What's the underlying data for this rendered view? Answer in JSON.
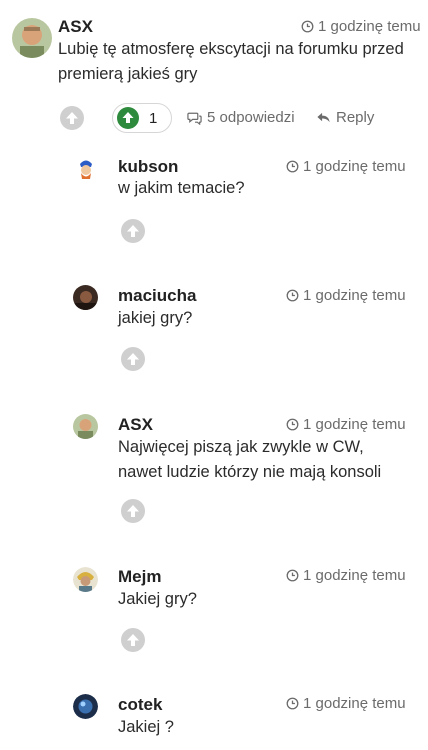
{
  "main_comment": {
    "author": "ASX",
    "time": "1 godzinę temu",
    "lines": [
      "Lubię tę atmosferę ekscytacji na forumku przed",
      "premierą jakieś gry"
    ],
    "votes": "1",
    "replies_label": "5 odpowiedzi",
    "reply_label": "Reply"
  },
  "replies": [
    {
      "author": "kubson",
      "time": "1 godzinę temu",
      "lines": [
        "w jakim temacie?"
      ]
    },
    {
      "author": "maciucha",
      "time": "1 godzinę temu",
      "lines": [
        "jakiej gry?"
      ]
    },
    {
      "author": "ASX",
      "time": "1 godzinę temu",
      "lines": [
        "Najwięcej piszą jak zwykle w CW,",
        "nawet ludzie którzy nie mają konsoli"
      ]
    },
    {
      "author": "Mejm",
      "time": "1 godzinę temu",
      "lines": [
        "Jakiej gry?"
      ]
    },
    {
      "author": "cotek",
      "time": "1 godzinę temu",
      "lines": [
        "Jakiej ?"
      ]
    }
  ],
  "icons": {
    "clock": "clock-icon",
    "upvote": "arrow-up-circle-icon",
    "replies": "comments-icon",
    "reply": "reply-arrow-icon"
  },
  "colors": {
    "upvote_active": "#2e8b3e",
    "upvote_inactive": "#cfcfcf",
    "muted_text": "#6b6b6b"
  }
}
